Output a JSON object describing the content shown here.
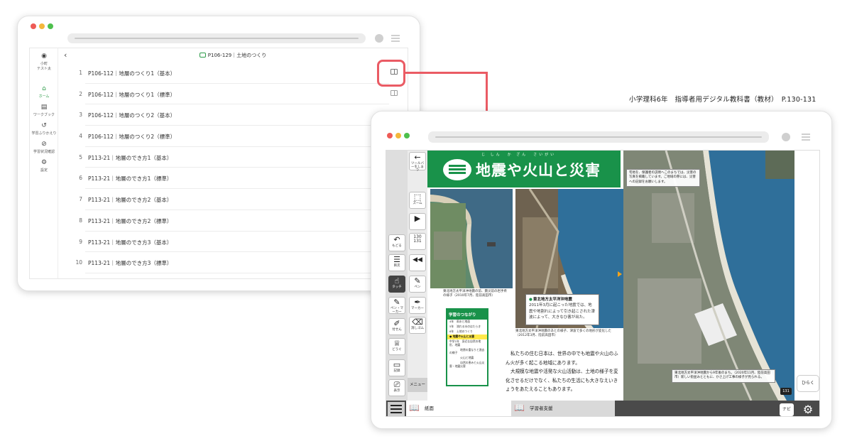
{
  "window1": {
    "user_label": "小町\nテスト太",
    "sidebar": [
      {
        "icon": "home-icon",
        "label": "ホーム",
        "active": true
      },
      {
        "icon": "workbook-icon",
        "label": "ワークブック",
        "active": false
      },
      {
        "icon": "history-icon",
        "label": "学習ふりかえり",
        "active": false
      },
      {
        "icon": "check-icon",
        "label": "学習状況確認",
        "active": false
      },
      {
        "icon": "settings-icon",
        "label": "設定",
        "active": false
      }
    ],
    "header_title": "P106-129｜土地のつくり",
    "rows": [
      {
        "num": "1",
        "label": "P106-112｜地層のつくり1（基本）"
      },
      {
        "num": "2",
        "label": "P106-112｜地層のつくり1（標準）"
      },
      {
        "num": "3",
        "label": "P106-112｜地層のつくり2（基本）"
      },
      {
        "num": "4",
        "label": "P106-112｜地層のつくり2（標準）"
      },
      {
        "num": "5",
        "label": "P113-21｜地層のでき方1（基本）"
      },
      {
        "num": "6",
        "label": "P113-21｜地層のでき方1（標準）"
      },
      {
        "num": "7",
        "label": "P113-21｜地層のでき方2（基本）"
      },
      {
        "num": "8",
        "label": "P113-21｜地層のでき方2（標準）"
      },
      {
        "num": "9",
        "label": "P113-21｜地層のでき方3（基本）"
      },
      {
        "num": "10",
        "label": "P113-21｜地層のでき方3（標準）"
      }
    ]
  },
  "caption": "小学理科6年　指導者用デジタル教科書（教材）　P.130-131",
  "window2": {
    "toolbar_left": [
      {
        "icon": "undo-icon",
        "glyph": "↶",
        "label": "もどる"
      },
      {
        "icon": "toc-icon",
        "glyph": "☰",
        "label": "目次"
      },
      {
        "icon": "touch-icon",
        "glyph": "☝",
        "label": "タッチ",
        "active": true
      },
      {
        "icon": "pen-marker-icon",
        "glyph": "✎",
        "label": "ペン・マーカー"
      },
      {
        "icon": "sticky-icon",
        "glyph": "✐",
        "label": "付せん"
      },
      {
        "icon": "tools-icon",
        "glyph": "♕",
        "label": "どうぐ"
      },
      {
        "icon": "record-icon",
        "glyph": "▭",
        "label": "記録"
      },
      {
        "icon": "display-icon",
        "glyph": "⎚",
        "label": "表示"
      }
    ],
    "toolbar_right": [
      {
        "icon": "toolbar-hide-icon",
        "glyph": "←",
        "label": "ツールバーをしまう"
      },
      {
        "icon": "zoom-icon",
        "glyph": "⬚",
        "label": "ズーム"
      },
      {
        "icon": "next-icon",
        "glyph": "▶",
        "label": ""
      },
      {
        "icon": "page-icon",
        "glyph": "",
        "label": "130\n131"
      },
      {
        "icon": "rewind-icon",
        "glyph": "◀◀",
        "label": ""
      },
      {
        "icon": "pen-icon",
        "glyph": "✎",
        "label": "ペン"
      },
      {
        "icon": "marker-icon",
        "glyph": "✒",
        "label": "マーカー"
      },
      {
        "icon": "eraser-icon",
        "glyph": "⌫",
        "label": "消しゴム"
      }
    ],
    "menu_label": "メニュー",
    "banner_title": "地震や火山と災害",
    "banner_ruby": "じ しん　か ざん　さいがい",
    "photo1_note": "東北地方太平洋沖地震の前、震災前の岩手県の様子（2010年7月、陸前高田市）",
    "photo2_note": "東北地方太平洋沖地震のあとの様子、津波で多くの地形が変化した（2012年3月、陸前高田市）",
    "callout_title": "東北地方太平洋沖地震",
    "callout_text": "2011年3月に起こった地震では、地震や地割れによって引き起こされた津波によって、大きなひ害が出た。",
    "link_box": {
      "title": "学習のつながり",
      "items": [
        {
          "text": "4年　雨水と地面",
          "hl": false
        },
        {
          "text": "5年　流れる水のはたらき",
          "hl": false
        },
        {
          "text": "6年　土地のつくり",
          "hl": false
        },
        {
          "text": "● 地震や火山と災害",
          "hl": true
        },
        {
          "text": "中学1年　身近な自然の地形、地震",
          "hl": false
        },
        {
          "text": "　　　　地層の重なりと過去の様子",
          "hl": false
        },
        {
          "text": "　　　　火山と地震",
          "hl": false
        },
        {
          "text": "　　　　自然の恵みと火山災害・地震災害",
          "hl": false
        }
      ]
    },
    "body_paragraphs": [
      "私たちの住む日本は、世界の中でも地震や火山のふん火が多く起こる地域にあります。",
      "大規模な地震や活発な火山活動は、土地の様子を変化させるだけでなく、私たちの生活にも大きなえいきょうをあたえることもあります。"
    ],
    "photo3_label_top": "宅地を、保護者の説明へこのまちでは、災害の写真を掲載しています。ご地域の際には、災害への記録をお願いします。",
    "photo3_label_bottom": "東北地方太平洋沖地震から9年後のまち。（2020年11月、陸前高田市）新しい街並みとともに、かさ上げ工事の様子が見られる。",
    "page_number": "131",
    "open_label": "ひらく",
    "tabs": [
      {
        "icon": "textbook-icon",
        "label": "紙面"
      },
      {
        "icon": "support-icon",
        "label": "学習者支援"
      }
    ],
    "navi_label": "ナビ"
  },
  "colors": {
    "accent_green": "#19924a",
    "highlight_red": "#ea5b64",
    "sea_blue": "#2f6f9a"
  }
}
